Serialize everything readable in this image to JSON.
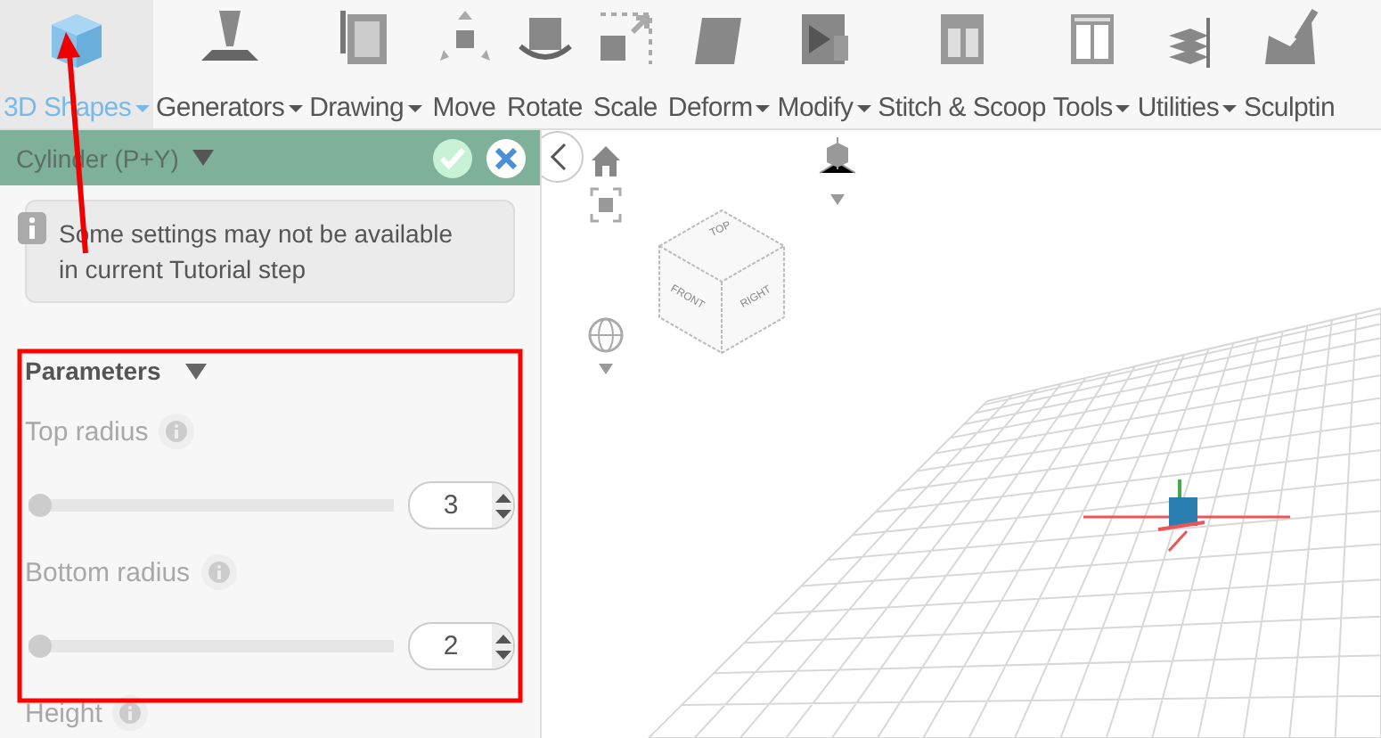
{
  "toolbar": {
    "tools": [
      {
        "label": "3D Shapes",
        "selected": true,
        "dropdown": true
      },
      {
        "label": "Generators",
        "selected": false,
        "dropdown": true
      },
      {
        "label": "Drawing",
        "selected": false,
        "dropdown": true
      },
      {
        "label": "Move",
        "selected": false,
        "dropdown": false
      },
      {
        "label": "Rotate",
        "selected": false,
        "dropdown": false
      },
      {
        "label": "Scale",
        "selected": false,
        "dropdown": false
      },
      {
        "label": "Deform",
        "selected": false,
        "dropdown": true
      },
      {
        "label": "Modify",
        "selected": false,
        "dropdown": true
      },
      {
        "label": "Stitch & Scoop",
        "selected": false,
        "dropdown": false
      },
      {
        "label": "Tools",
        "selected": false,
        "dropdown": true
      },
      {
        "label": "Utilities",
        "selected": false,
        "dropdown": true
      },
      {
        "label": "Sculptin",
        "selected": false,
        "dropdown": false
      }
    ]
  },
  "panel": {
    "title": "Cylinder (P+Y)",
    "notice": "Some settings may not be available in current Tutorial step",
    "section": {
      "title": "Parameters",
      "expanded": true,
      "params": [
        {
          "label": "Top radius",
          "disabled": true,
          "level": 0,
          "value": "3"
        },
        {
          "label": "Bottom radius",
          "disabled": true,
          "level": 0,
          "value": "2"
        },
        {
          "label": "Height",
          "disabled": true
        }
      ]
    }
  },
  "viewport": {
    "view_cube": {
      "faces": [
        "TOP",
        "FRONT",
        "RIGHT"
      ]
    }
  },
  "annotations": {
    "arrow": true,
    "highlight_frame": true
  }
}
